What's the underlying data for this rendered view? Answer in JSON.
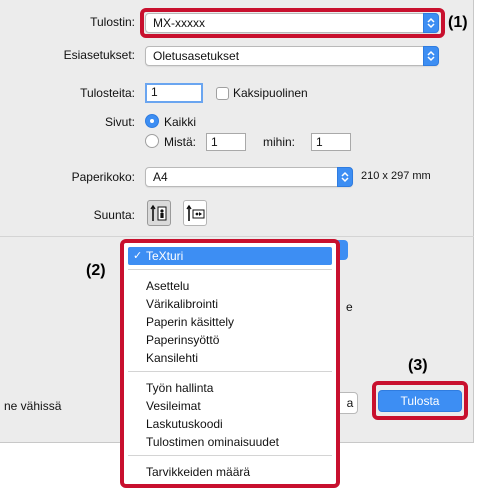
{
  "printer": {
    "label": "Tulostin:",
    "value": "MX-xxxxx"
  },
  "presets": {
    "label": "Esiasetukset:",
    "value": "Oletusasetukset"
  },
  "copies": {
    "label": "Tulosteita:",
    "value": "1",
    "duplex_label": "Kaksipuolinen"
  },
  "pages": {
    "label": "Sivut:",
    "all_label": "Kaikki",
    "from_label": "Mistä:",
    "from_value": "1",
    "to_label": "mihin:",
    "to_value": "1"
  },
  "paper": {
    "label": "Paperikoko:",
    "value": "A4",
    "dims": "210 x 297 mm"
  },
  "orientation": {
    "label": "Suunta:"
  },
  "panel_menu": {
    "items": [
      "TeXturi",
      "Asettelu",
      "Värikalibrointi",
      "Paperin käsittely",
      "Paperinsyöttö",
      "Kansilehti",
      "Työn hallinta",
      "Vesileimat",
      "Laskutuskoodi",
      "Tulostimen ominaisuudet",
      "Tarvikkeiden määrä"
    ],
    "selected": "TeXturi",
    "check": "✓"
  },
  "bottom": {
    "left_text": "ne vähissä",
    "partial_button": "a",
    "print_button": "Tulosta",
    "partial_e": "e"
  },
  "callouts": {
    "c1": "(1)",
    "c2": "(2)",
    "c3": "(3)"
  },
  "colors": {
    "accent": "#3d8ef3",
    "callout": "#c8102e"
  }
}
